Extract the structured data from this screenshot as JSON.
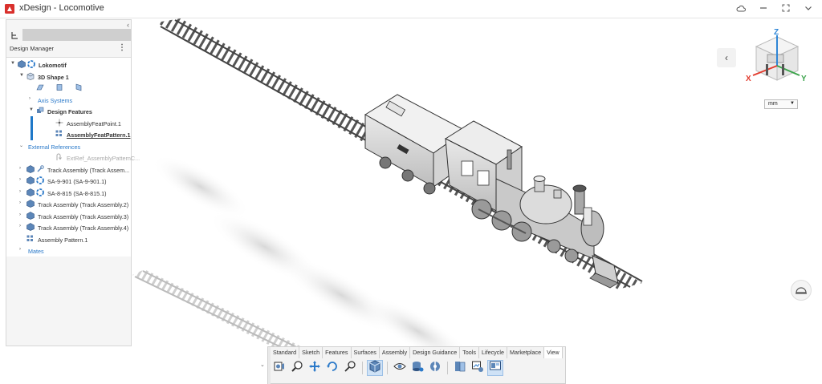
{
  "app": {
    "title": "xDesign - Locomotive"
  },
  "panel": {
    "header": "Design Manager",
    "tree": [
      {
        "label": "Lokomotif",
        "level": 0,
        "arrow": "▼",
        "style": "bold",
        "icons": [
          "assembly-icon",
          "instance-icon"
        ]
      },
      {
        "label": "3D Shape 1",
        "level": 1,
        "arrow": "▼",
        "style": "bold",
        "icons": [
          "shape-icon"
        ]
      },
      {
        "label": "",
        "level": 2,
        "arrow": "",
        "style": "",
        "icons": [
          "plane-xy-icon",
          "plane-yz-icon",
          "plane-zx-icon"
        ]
      },
      {
        "label": "Axis Systems",
        "level": 2,
        "arrow": "›",
        "style": "link",
        "icons": []
      },
      {
        "label": "Design Features",
        "level": 2,
        "arrow": "▼",
        "style": "bold",
        "icons": [
          "features-icon"
        ]
      },
      {
        "label": "AssemblyFeatPoint.1",
        "level": 3,
        "arrow": "",
        "style": "",
        "icons": [
          "point-icon"
        ]
      },
      {
        "label": "AssemblyFeatPattern.1",
        "level": 3,
        "arrow": "",
        "style": "bold-underline",
        "icons": [
          "pattern-icon"
        ]
      },
      {
        "label": "External References",
        "level": 1,
        "arrow": "⌄",
        "style": "link",
        "icons": []
      },
      {
        "label": "ExtRef_AssemblyPatternC...",
        "level": 3,
        "arrow": "",
        "style": "dim",
        "icons": [
          "extref-icon"
        ]
      },
      {
        "label": "Track Assembly (Track Assem...",
        "level": 1,
        "arrow": "›",
        "style": "",
        "icons": [
          "assembly-icon",
          "wrench-icon"
        ]
      },
      {
        "label": "SA-9-901 (SA-9-901.1)",
        "level": 1,
        "arrow": "›",
        "style": "",
        "icons": [
          "assembly-icon",
          "instance-icon"
        ]
      },
      {
        "label": "SA-8-815 (SA-8-815.1)",
        "level": 1,
        "arrow": "›",
        "style": "",
        "icons": [
          "assembly-icon",
          "instance-icon"
        ]
      },
      {
        "label": "Track Assembly (Track Assembly.2)",
        "level": 1,
        "arrow": "›",
        "style": "",
        "icons": [
          "assembly-icon"
        ]
      },
      {
        "label": "Track Assembly (Track Assembly.3)",
        "level": 1,
        "arrow": "›",
        "style": "",
        "icons": [
          "assembly-icon"
        ]
      },
      {
        "label": "Track Assembly (Track Assembly.4)",
        "level": 1,
        "arrow": "›",
        "style": "",
        "icons": [
          "assembly-icon"
        ]
      },
      {
        "label": "Assembly Pattern.1",
        "level": 1,
        "arrow": "",
        "style": "",
        "icons": [
          "pattern-icon"
        ]
      },
      {
        "label": "Mates",
        "level": 1,
        "arrow": "›",
        "style": "link",
        "icons": []
      }
    ]
  },
  "viewcube": {
    "x_label": "X",
    "y_label": "Y",
    "z_label": "Z"
  },
  "units": {
    "selected": "mm"
  },
  "toolbar": {
    "tabs": [
      "Standard",
      "Sketch",
      "Features",
      "Surfaces",
      "Assembly",
      "Design Guidance",
      "Tools",
      "Lifecycle",
      "Marketplace",
      "View"
    ],
    "active_tab": "View",
    "icons": [
      "camera-icon",
      "zoom-icon",
      "pan-icon",
      "rotate-icon",
      "zoom-area-icon",
      "view-mode-icon",
      "visibility-icon",
      "render-style-icon",
      "section-icon",
      "page-icon",
      "capture-icon",
      "display-icon"
    ]
  },
  "colors": {
    "link": "#2a79c9",
    "accent": "#1f78c8",
    "logo": "#d9302c",
    "axis_x": "#e23b2e",
    "axis_y": "#3ba34b",
    "axis_z": "#2f86d6"
  }
}
